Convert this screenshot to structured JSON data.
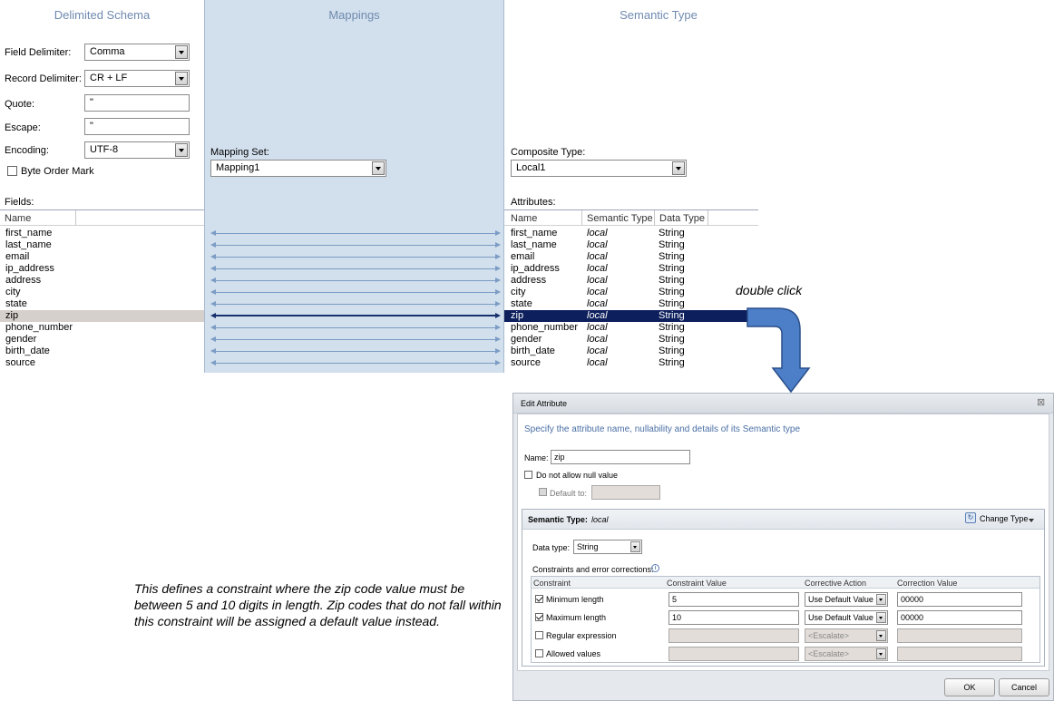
{
  "columns": {
    "left_title": "Delimited Schema",
    "middle_title": "Mappings",
    "right_title": "Semantic Type"
  },
  "schema": {
    "field_delimiter_label": "Field Delimiter:",
    "field_delimiter_value": "Comma",
    "record_delimiter_label": "Record Delimiter:",
    "record_delimiter_value": "CR + LF",
    "quote_label": "Quote:",
    "quote_value": "\"",
    "escape_label": "Escape:",
    "escape_value": "\"",
    "encoding_label": "Encoding:",
    "encoding_value": "UTF-8",
    "bom_label": "Byte Order Mark",
    "fields_label": "Fields:",
    "name_header": "Name",
    "fields": [
      "first_name",
      "last_name",
      "email",
      "ip_address",
      "address",
      "city",
      "state",
      "zip",
      "phone_number",
      "gender",
      "birth_date",
      "source"
    ]
  },
  "mapping": {
    "set_label": "Mapping Set:",
    "set_value": "Mapping1",
    "selected_index": 7
  },
  "semantic": {
    "composite_label": "Composite Type:",
    "composite_value": "Local1",
    "attributes_label": "Attributes:",
    "headers": {
      "name": "Name",
      "semantic_type": "Semantic Type",
      "data_type": "Data Type"
    },
    "rows": [
      {
        "name": "first_name",
        "semantic": "local",
        "type": "String"
      },
      {
        "name": "last_name",
        "semantic": "local",
        "type": "String"
      },
      {
        "name": "email",
        "semantic": "local",
        "type": "String"
      },
      {
        "name": "ip_address",
        "semantic": "local",
        "type": "String"
      },
      {
        "name": "address",
        "semantic": "local",
        "type": "String"
      },
      {
        "name": "city",
        "semantic": "local",
        "type": "String"
      },
      {
        "name": "state",
        "semantic": "local",
        "type": "String"
      },
      {
        "name": "zip",
        "semantic": "local",
        "type": "String"
      },
      {
        "name": "phone_number",
        "semantic": "local",
        "type": "String"
      },
      {
        "name": "gender",
        "semantic": "local",
        "type": "String"
      },
      {
        "name": "birth_date",
        "semantic": "local",
        "type": "String"
      },
      {
        "name": "source",
        "semantic": "local",
        "type": "String"
      }
    ]
  },
  "annotation": {
    "double_click": "double click",
    "explanation": "This defines a constraint where the zip code value must be between 5 and 10 digits in length.  Zip codes that do not fall within this constraint will be assigned a default value instead."
  },
  "dialog": {
    "title": "Edit Attribute",
    "subtitle": "Specify the attribute name, nullability and details of its Semantic type",
    "name_label": "Name:",
    "name_value": "zip",
    "no_null_label": "Do not allow null value",
    "default_label": "Default to:",
    "semantic_type_label": "Semantic Type:",
    "semantic_type_value": "local",
    "change_type": "Change Type",
    "data_type_label": "Data type:",
    "data_type_value": "String",
    "constraints_label": "Constraints and error corrections:",
    "grid_headers": {
      "constraint": "Constraint",
      "value": "Constraint Value",
      "action": "Corrective Action",
      "correction": "Correction Value"
    },
    "grid_rows": [
      {
        "constraint": "Minimum length",
        "checked": true,
        "value": "5",
        "action": "Use Default Value",
        "correction": "00000",
        "enabled": true
      },
      {
        "constraint": "Maximum length",
        "checked": true,
        "value": "10",
        "action": "Use Default Value",
        "correction": "00000",
        "enabled": true
      },
      {
        "constraint": "Regular expression",
        "checked": false,
        "value": "",
        "action": "<Escalate>",
        "correction": "",
        "enabled": false
      },
      {
        "constraint": "Allowed values",
        "checked": false,
        "value": "",
        "action": "<Escalate>",
        "correction": "",
        "enabled": false
      }
    ],
    "ok_label": "OK",
    "cancel_label": "Cancel"
  },
  "colors": {
    "mapping_panel": "#d2dfec",
    "title_blue": "#6f8ab0",
    "selection": "#0d1f5c",
    "arrow_fill": "#4d7fc8",
    "arrow_stroke": "#2a4f8a"
  }
}
